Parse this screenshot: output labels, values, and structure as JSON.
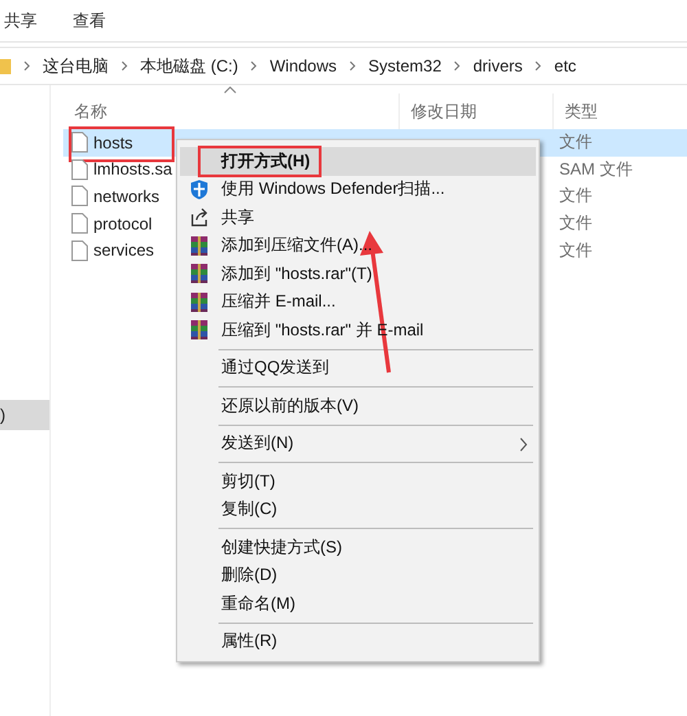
{
  "ribbon_tabs": [
    {
      "label": "共享"
    },
    {
      "label": "查看"
    }
  ],
  "address_bar": {
    "crumbs": [
      "这台电脑",
      "本地磁盘 (C:)",
      "Windows",
      "System32",
      "drivers",
      "etc"
    ]
  },
  "navigation_pane": {
    "items": [
      {
        "label": ")",
        "selected": true
      }
    ]
  },
  "file_list": {
    "columns": [
      "名称",
      "修改日期",
      "类型"
    ],
    "rows": [
      {
        "name": "hosts",
        "type": "文件",
        "selected": true,
        "outlined": true
      },
      {
        "name": "lmhosts.sa",
        "type": "SAM 文件",
        "selected": false,
        "outlined": false
      },
      {
        "name": "networks",
        "type": "文件",
        "selected": false,
        "outlined": false
      },
      {
        "name": "protocol",
        "type": "文件",
        "selected": false,
        "outlined": false
      },
      {
        "name": "services",
        "type": "文件",
        "selected": false,
        "outlined": false
      }
    ]
  },
  "context_menu": {
    "pointer_arrow": true,
    "items": [
      {
        "kind": "plain",
        "label": "打开方式(H)",
        "bold": true,
        "highlighted": true,
        "outlined": true
      },
      {
        "kind": "defender",
        "label": "使用 Windows Defender扫描...",
        "highlighted": false
      },
      {
        "kind": "share",
        "label": "共享",
        "highlighted": false
      },
      {
        "kind": "archive",
        "label": "添加到压缩文件(A)...",
        "highlighted": false
      },
      {
        "kind": "archive",
        "label": "添加到 \"hosts.rar\"(T)",
        "highlighted": false
      },
      {
        "kind": "archive",
        "label": "压缩并 E-mail...",
        "highlighted": false
      },
      {
        "kind": "archive",
        "label": "压缩到 \"hosts.rar\" 并 E-mail",
        "highlighted": false
      },
      {
        "kind": "separator"
      },
      {
        "kind": "plain",
        "label": "通过QQ发送到",
        "highlighted": false
      },
      {
        "kind": "separator"
      },
      {
        "kind": "plain",
        "label": "还原以前的版本(V)",
        "highlighted": false
      },
      {
        "kind": "separator"
      },
      {
        "kind": "plain",
        "label": "发送到(N)",
        "submenu": true,
        "highlighted": false
      },
      {
        "kind": "separator"
      },
      {
        "kind": "plain",
        "label": "剪切(T)",
        "highlighted": false
      },
      {
        "kind": "plain",
        "label": "复制(C)",
        "highlighted": false
      },
      {
        "kind": "separator"
      },
      {
        "kind": "plain",
        "label": "创建快捷方式(S)",
        "highlighted": false
      },
      {
        "kind": "plain",
        "label": "删除(D)",
        "highlighted": false
      },
      {
        "kind": "plain",
        "label": "重命名(M)",
        "highlighted": false
      },
      {
        "kind": "separator"
      },
      {
        "kind": "plain",
        "label": "属性(R)",
        "highlighted": false
      }
    ]
  }
}
